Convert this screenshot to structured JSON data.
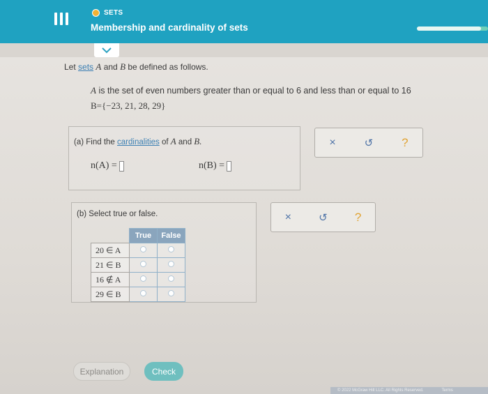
{
  "header": {
    "topic": "SETS",
    "title": "Membership and cardinality of sets",
    "progress": 0.9
  },
  "intro": {
    "prefix": "Let",
    "link": "sets",
    "var_a": "A",
    "and": "and",
    "var_b": "B",
    "suffix": "be defined as follows."
  },
  "definitions": {
    "a_var": "A",
    "a_text": "is the set of even numbers greater than or equal to 6 and less than or equal to 16",
    "b_text": "B={−23, 21, 28, 29}"
  },
  "part_a": {
    "prefix": "(a) Find the",
    "link": "cardinalities",
    "of": "of",
    "var_a": "A",
    "and": "and",
    "var_b": "B.",
    "expr_a": "n(A) =",
    "expr_b": "n(B) ="
  },
  "part_b": {
    "label": "(b) Select true or false.",
    "columns": [
      "True",
      "False"
    ],
    "rows": [
      "20 ∈ A",
      "21 ∈ B",
      "16 ∉ A",
      "29 ∈ B"
    ]
  },
  "actions": {
    "x": "×",
    "undo": "↺",
    "help": "?"
  },
  "buttons": {
    "explanation": "Explanation",
    "check": "Check"
  },
  "footer": {
    "copyright": "© 2022 McGraw Hill LLC. All Rights Reserved.",
    "terms": "Terms"
  },
  "colors": {
    "header_bg": "#1fa2c1",
    "accent": "#6fbfbf",
    "link": "#3b7fb3",
    "help": "#e1a332"
  }
}
